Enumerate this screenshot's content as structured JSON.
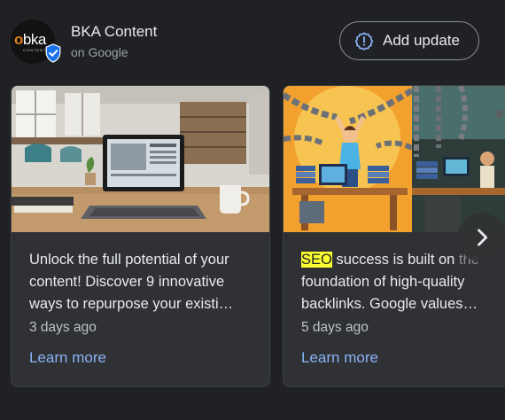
{
  "header": {
    "logo_text_prefix": "o",
    "logo_text_main": "bka",
    "logo_subtext": "CONTENT",
    "business_name": "BKA Content",
    "source": "on Google",
    "add_update_label": "Add update"
  },
  "posts": [
    {
      "text": "Unlock the full potential of your content! Discover 9 innovative ways to repurpose your existi…",
      "date": "3 days ago",
      "link_label": "Learn more"
    },
    {
      "highlight": "SEO",
      "text_main": " success is built on",
      "text_faded": " the",
      "text_rest": " foundation of high-quality backlinks. Google values…",
      "date": "5 days ago",
      "link_label": "Learn more"
    }
  ],
  "icons": {
    "verified": "verified-badge-icon",
    "add_update": "add-update-icon",
    "next": "chevron-right-icon"
  },
  "colors": {
    "background": "#202124",
    "card": "#303134",
    "link": "#8ab4f8",
    "highlight": "#fbff30",
    "verified": "#1a73e8"
  }
}
